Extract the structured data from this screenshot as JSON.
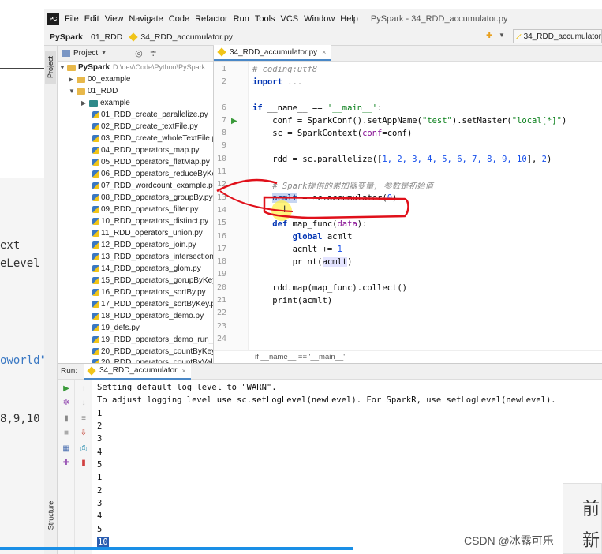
{
  "background_code": [
    "ext",
    "eLevel",
    "oworld\"",
    "8,9,10"
  ],
  "menu": {
    "app_icon": "PC",
    "items": [
      "File",
      "Edit",
      "View",
      "Navigate",
      "Code",
      "Refactor",
      "Run",
      "Tools",
      "VCS",
      "Window",
      "Help"
    ],
    "window_title": "PySpark - 34_RDD_accumulator.py"
  },
  "nav": {
    "crumbs": [
      "PySpark",
      "01_RDD",
      "34_RDD_accumulator.py"
    ],
    "run_config": "34_RDD_accumulator"
  },
  "toolstrip": {
    "project": "Project",
    "structure": "Structure"
  },
  "project": {
    "header": "Project",
    "root": {
      "name": "PySpark",
      "path": "D:\\dev\\Code\\Python\\PySpark"
    },
    "folders": [
      "00_example",
      "01_RDD",
      "example"
    ],
    "files": [
      "01_RDD_create_parallelize.py",
      "02_RDD_create_textFile.py",
      "03_RDD_create_wholeTextFile.py",
      "04_RDD_operators_map.py",
      "05_RDD_operators_flatMap.py",
      "06_RDD_operators_reduceByKey.py",
      "07_RDD_wordcount_example.py",
      "08_RDD_operators_groupBy.py",
      "09_RDD_operators_filter.py",
      "10_RDD_operators_distinct.py",
      "11_RDD_operators_union.py",
      "12_RDD_operators_join.py",
      "13_RDD_operators_intersection.py",
      "14_RDD_operators_glom.py",
      "15_RDD_operators_gorupByKey.py",
      "16_RDD_operators_sortBy.py",
      "17_RDD_operators_sortByKey.py",
      "18_RDD_operators_demo.py",
      "19_defs.py",
      "19_RDD_operators_demo_run_yarn.py",
      "20_RDD_operators_countByKey.py",
      "20_RDD_operators_countByValue.py"
    ]
  },
  "editor": {
    "tab": "34_RDD_accumulator.py",
    "line_numbers": [
      "1",
      "2",
      "6",
      "7",
      "8",
      "9",
      "10",
      "11",
      "12",
      "13",
      "14",
      "15",
      "16",
      "17",
      "18",
      "19",
      "20",
      "21",
      "22",
      "23",
      "24"
    ],
    "code": {
      "l1": "# coding:utf8",
      "l2_kw": "import",
      "l2_rest": " ...",
      "l7_kw": "if",
      "l7_a": " __name__ == ",
      "l7_str": "'__main__'",
      "l7_b": ":",
      "l8_a": "    conf = SparkConf().setAppName(",
      "l8_s1": "\"test\"",
      "l8_b": ").setMaster(",
      "l8_s2": "\"local[*]\"",
      "l8_c": ")",
      "l9_a": "    sc = SparkContext(",
      "l9_p": "conf",
      "l9_b": "=conf)",
      "l11_a": "    rdd = sc.parallelize([",
      "l11_nums": "1, 2, 3, 4, 5, 6, 7, 8, 9, 10",
      "l11_b": "], ",
      "l11_n": "2",
      "l11_c": ")",
      "l13": "    # Spark提供的累加器变量, 参数是初始值",
      "l14_a": "acmlt",
      "l14_b": " = sc.accumulator(",
      "l14_n": "0",
      "l14_c": ")",
      "l16_kw": "def",
      "l16_a": " map_func(",
      "l16_p": "data",
      "l16_b": "):",
      "l17_kw": "global",
      "l17_a": " acmlt",
      "l18_a": "        acmlt += ",
      "l18_n": "1",
      "l19_a": "        print(",
      "l19_h": "acmlt",
      "l19_b": ")",
      "l21": "    rdd.map(map_func).collect()",
      "l22": "    print(acmlt)"
    },
    "breadcrumb": "if __name__ == '__main__'"
  },
  "run": {
    "label": "Run:",
    "tab": "34_RDD_accumulator",
    "lines": [
      "Setting default log level to \"WARN\".",
      "To adjust logging level use sc.setLogLevel(newLevel). For SparkR, use setLogLevel(newLevel).",
      "1",
      "2",
      "3",
      "4",
      "5",
      "1",
      "2",
      "3",
      "4",
      "5",
      "10"
    ]
  },
  "overlay": {
    "line1": "前",
    "line2": "新"
  },
  "watermark": "CSDN @冰露可乐",
  "colors": {
    "keyword": "#0033b3",
    "string": "#067d17",
    "number": "#1750eb",
    "comment": "#8c8c8c",
    "annotation": "#e0101a",
    "accent": "#1a8fe6"
  }
}
